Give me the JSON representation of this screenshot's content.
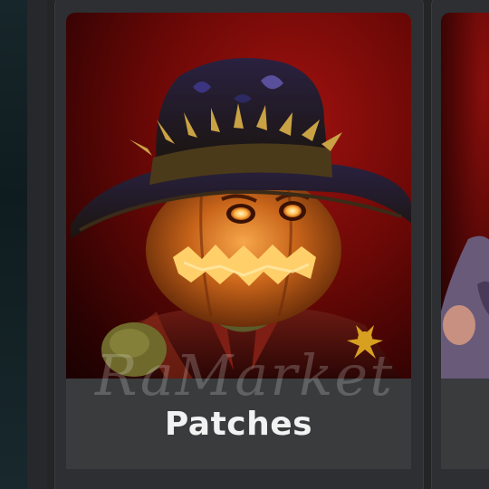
{
  "item_card": {
    "name": "Patches",
    "watermark": "RaMarket"
  },
  "colors": {
    "page_background": "#232527",
    "card_background": "#2d2f32",
    "caption_background": "#393b3d",
    "name_text": "#f2f2f2",
    "thumbnail_red": "#a0120f"
  }
}
